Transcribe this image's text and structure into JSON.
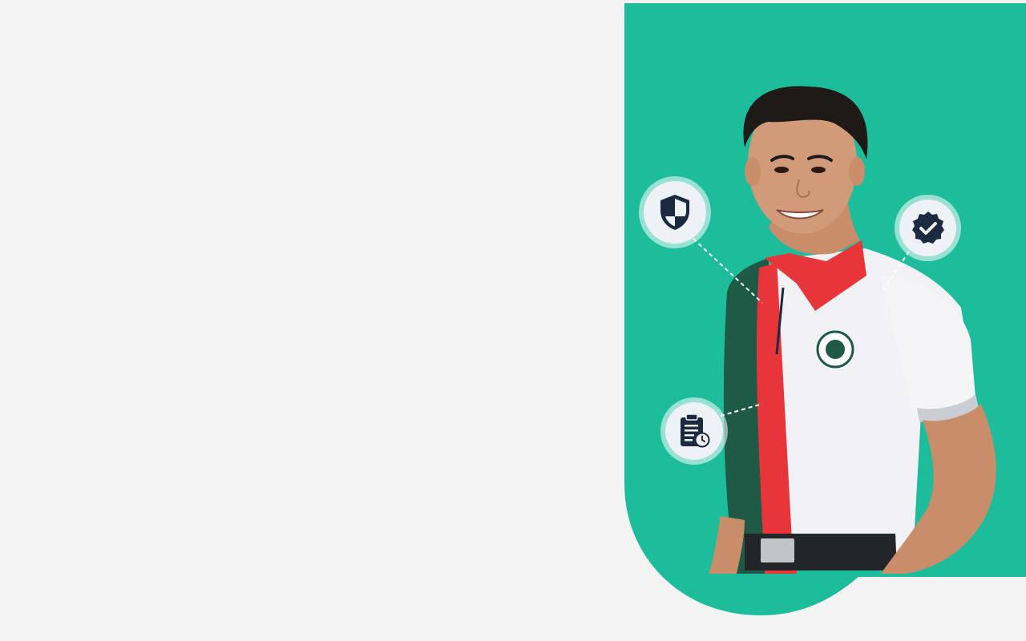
{
  "hero": {
    "background_color": "#1dbd9b",
    "page_background": "#f3f3f3",
    "image_subject": "person-in-polo-shirt"
  },
  "badges": [
    {
      "icon": "shield-icon",
      "color": "#1b2a41"
    },
    {
      "icon": "verified-badge-icon",
      "color": "#1b2a41"
    },
    {
      "icon": "clipboard-clock-icon",
      "color": "#1b2a41"
    }
  ]
}
